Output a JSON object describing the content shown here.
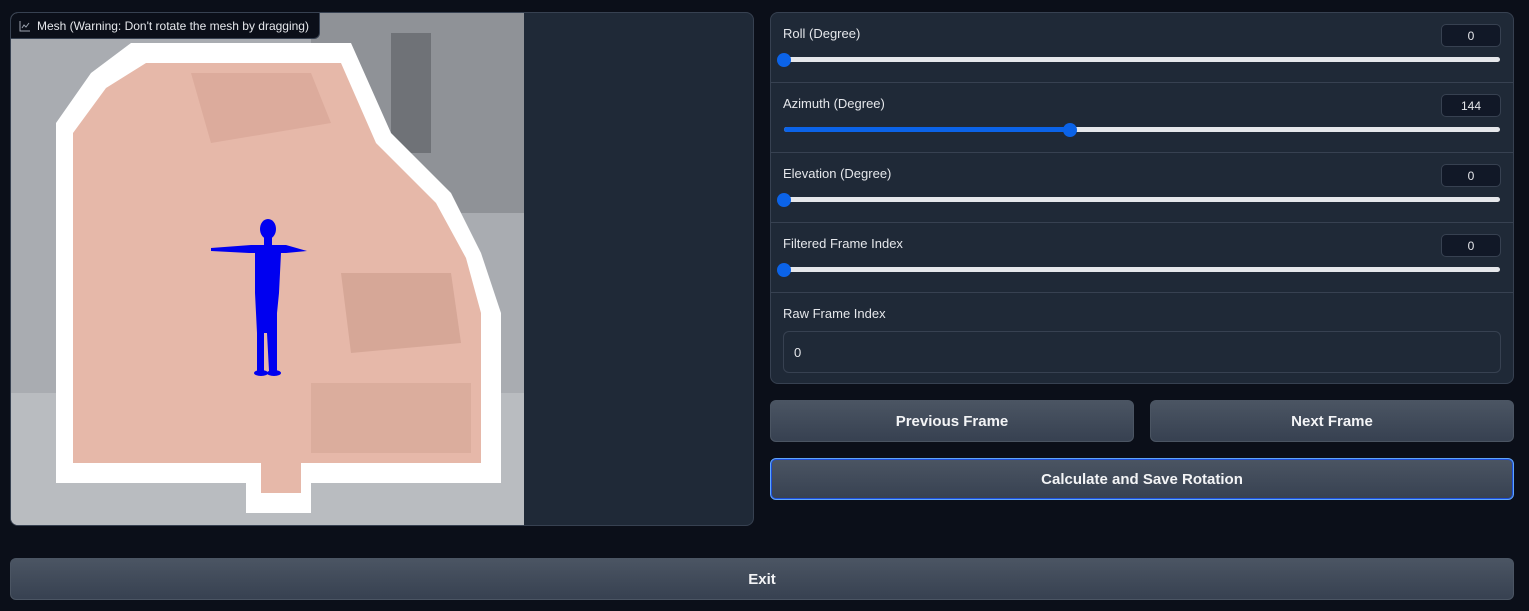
{
  "mesh": {
    "label": "Mesh (Warning: Don't rotate the mesh by dragging)",
    "icon": "chart-icon"
  },
  "controls": {
    "roll": {
      "label": "Roll (Degree)",
      "value": "0",
      "fraction": 0.0
    },
    "azimuth": {
      "label": "Azimuth (Degree)",
      "value": "144",
      "fraction": 0.4
    },
    "elevation": {
      "label": "Elevation (Degree)",
      "value": "0",
      "fraction": 0.0
    },
    "filtered_frame": {
      "label": "Filtered Frame Index",
      "value": "0",
      "fraction": 0.0
    },
    "raw_frame": {
      "label": "Raw Frame Index",
      "value": "0"
    }
  },
  "buttons": {
    "previous": "Previous Frame",
    "next": "Next Frame",
    "calculate": "Calculate and Save Rotation",
    "exit": "Exit"
  },
  "colors": {
    "accent": "#0b63e8",
    "panel": "#1f2937",
    "background": "#0b0f19",
    "figure": "#0000f0"
  }
}
